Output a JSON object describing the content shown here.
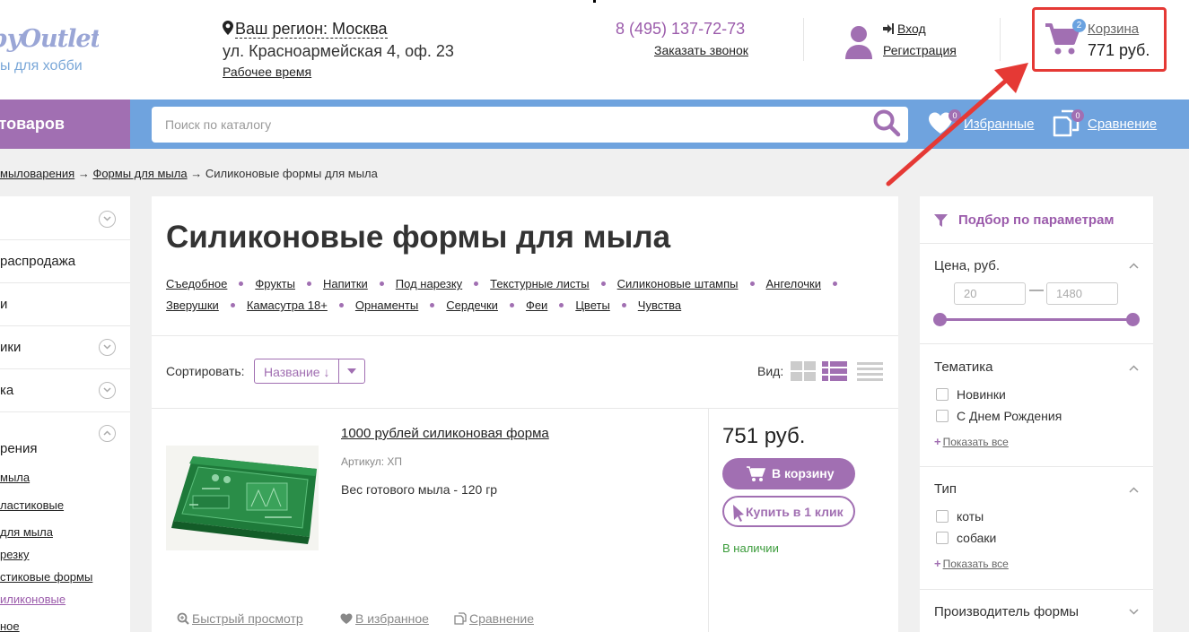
{
  "header": {
    "logo_text": "bbyOutlet",
    "logo_sub": "ы для хобби",
    "region_label": "Ваш регион: Москва",
    "address": "ул. Красноармейская 4, оф. 23",
    "hours_link": "Рабочее время",
    "phone": "8 (495) 137-72-73",
    "callback_link": "Заказать звонок",
    "login_link": "Вход",
    "register_link": "Регистрация",
    "cart": {
      "label": "Корзина",
      "sum": "771 руб.",
      "count": "2"
    }
  },
  "navbar": {
    "catalog_label": "г товаров",
    "search_placeholder": "Поиск по каталогу",
    "favorites_label": "Избранные",
    "favorites_count": "0",
    "compare_label": "Сравнение",
    "compare_count": "0"
  },
  "breadcrumb": {
    "items": [
      "мыловарения",
      "Формы для мыла"
    ],
    "current": "Силиконовые формы для мыла",
    "separator": "→"
  },
  "sidebar": {
    "items": [
      {
        "label": ""
      },
      {
        "label": "распродажа"
      },
      {
        "label": "и"
      },
      {
        "label": "ики"
      },
      {
        "label": "ка"
      },
      {
        "label": "рения"
      }
    ],
    "subitems": [
      {
        "label": "мыла"
      },
      {
        "label": "ластиковые"
      },
      {
        "label": "для мыла"
      },
      {
        "label": "резку"
      },
      {
        "label": "стиковые формы"
      },
      {
        "label": "иликоновые"
      },
      {
        "label": "ное"
      }
    ]
  },
  "main": {
    "title": "Силиконовые формы для мыла",
    "tags_row1": [
      "Съедобное",
      "Фрукты",
      "Напитки",
      "Под нарезку",
      "Текстурные листы",
      "Силиконовые штампы",
      "Ангелочки"
    ],
    "tags_row2": [
      "Зверушки",
      "Камасутра 18+",
      "Орнаменты",
      "Сердечки",
      "Феи",
      "Цветы",
      "Чувства"
    ],
    "sort_label": "Сортировать:",
    "sort_value": "Название ↓",
    "view_label": "Вид:",
    "product": {
      "title": "1000 рублей силиконовая форма",
      "sku": "Артикул: ХП",
      "description": "Вес готового мыла - 120 гр",
      "price": "751 руб.",
      "add_to_cart": "В корзину",
      "one_click": "Купить в 1 клик",
      "stock": "В наличии",
      "quick_view": "Быстрый просмотр",
      "add_favorite": "В избранное",
      "compare": "Сравнение"
    }
  },
  "filters": {
    "title": "Подбор по параметрам",
    "price": {
      "label": "Цена, руб.",
      "min": "20",
      "max": "1480"
    },
    "theme": {
      "label": "Тематика",
      "options": [
        "Новинки",
        "С Днем Рождения"
      ],
      "show_all": "Показать все"
    },
    "type": {
      "label": "Тип",
      "options": [
        "коты",
        "собаки"
      ],
      "show_all": "Показать все"
    },
    "manufacturer": {
      "label": "Производитель формы"
    }
  },
  "colors": {
    "accent_purple": "#a16fb2",
    "nav_blue": "#6fa3de",
    "highlight_red": "#e53935",
    "stock_green": "#3a9b3a"
  }
}
